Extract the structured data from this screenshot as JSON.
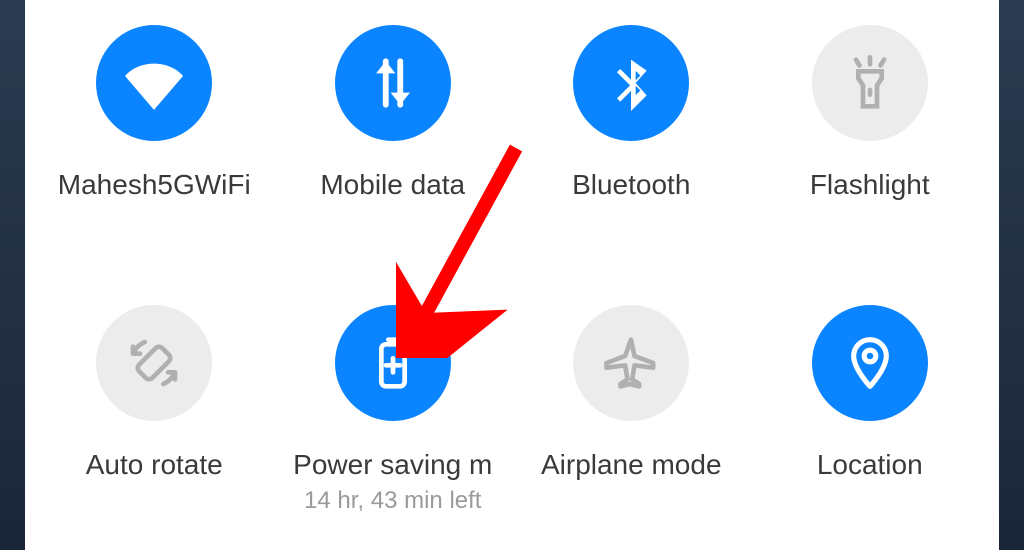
{
  "colors": {
    "accent": "#0a84ff",
    "off": "#ececec"
  },
  "tiles": {
    "wifi": {
      "label": "Mahesh5GWiFi",
      "state": "on",
      "sub": ""
    },
    "mobile": {
      "label": "Mobile data",
      "state": "on",
      "sub": ""
    },
    "bluetooth": {
      "label": "Bluetooth",
      "state": "on",
      "sub": ""
    },
    "flashlight": {
      "label": "Flashlight",
      "state": "off",
      "sub": ""
    },
    "autorotate": {
      "label": "Auto rotate",
      "state": "off",
      "sub": ""
    },
    "powersave": {
      "label": "Power saving m",
      "state": "on",
      "sub": "14 hr, 43 min left"
    },
    "airplane": {
      "label": "Airplane mode",
      "state": "off",
      "sub": ""
    },
    "location": {
      "label": "Location",
      "state": "on",
      "sub": ""
    }
  },
  "annotation": {
    "target": "powersave"
  }
}
